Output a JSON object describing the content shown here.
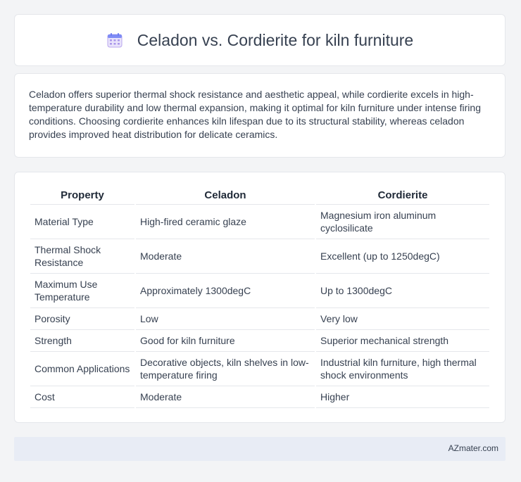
{
  "header": {
    "title": "Celadon vs. Cordierite for kiln furniture",
    "icon": "calendar-icon"
  },
  "summary": "Celadon offers superior thermal shock resistance and aesthetic appeal, while cordierite excels in high-temperature durability and low thermal expansion, making it optimal for kiln furniture under intense firing conditions. Choosing cordierite enhances kiln lifespan due to its structural stability, whereas celadon provides improved heat distribution for delicate ceramics.",
  "table": {
    "headers": [
      "Property",
      "Celadon",
      "Cordierite"
    ],
    "rows": [
      [
        "Material Type",
        "High-fired ceramic glaze",
        "Magnesium iron aluminum cyclosilicate"
      ],
      [
        "Thermal Shock Resistance",
        "Moderate",
        "Excellent (up to 1250degC)"
      ],
      [
        "Maximum Use Temperature",
        "Approximately 1300degC",
        "Up to 1300degC"
      ],
      [
        "Porosity",
        "Low",
        "Very low"
      ],
      [
        "Strength",
        "Good for kiln furniture",
        "Superior mechanical strength"
      ],
      [
        "Common Applications",
        "Decorative objects, kiln shelves in low-temperature firing",
        "Industrial kiln furniture, high thermal shock environments"
      ],
      [
        "Cost",
        "Moderate",
        "Higher"
      ]
    ]
  },
  "footer": {
    "brand": "AZmater.com"
  }
}
